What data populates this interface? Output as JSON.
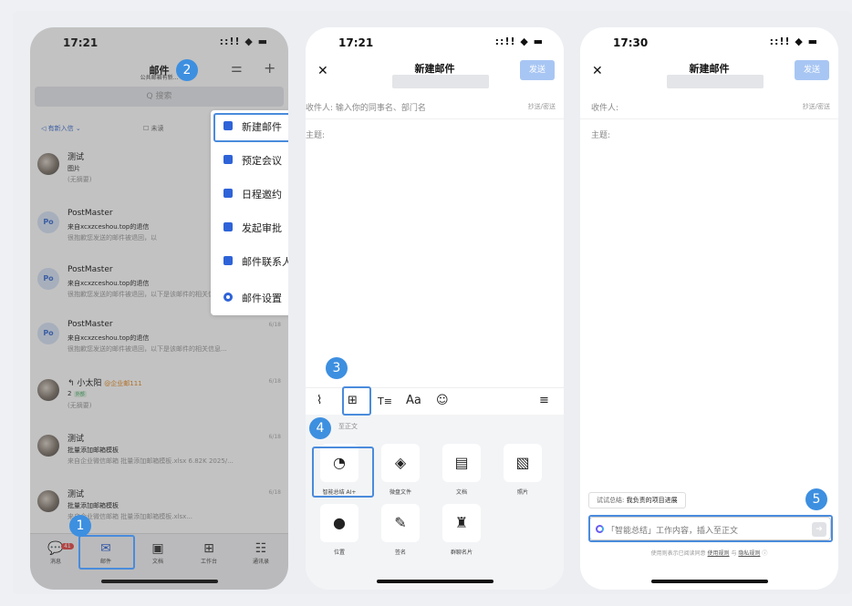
{
  "phone1": {
    "status_time": "17:21",
    "status_icons": "::!! ◆ ▬",
    "header_title": "邮件",
    "header_subtitle": "公共邮箱有新...",
    "filter_icon": "sliders-icon",
    "add_icon": "plus-icon",
    "search_placeholder": "Q 搜索",
    "filter_label": "有新入信",
    "unread_label": "未读",
    "mails": [
      {
        "sender": "测试",
        "subject": "图片",
        "preview": "(无摘要)",
        "date": ""
      },
      {
        "sender": "PostMaster",
        "subject": "来自xcxzceshou.top的退信",
        "preview": "很抱歉您发送的邮件被退回，以",
        "date": ""
      },
      {
        "sender": "PostMaster",
        "subject": "来自xcxzceshou.top的退信",
        "preview": "很抱歉您发送的邮件被退回，以下是该邮件的相关信息...",
        "date": ""
      },
      {
        "sender": "PostMaster",
        "subject": "来自xcxzceshou.top的退信",
        "preview": "很抱歉您发送的邮件被退回，以下是该邮件的相关信息...",
        "date": "6/18"
      },
      {
        "sender": "小太阳",
        "sender_tag": "@企业邮111",
        "subject": "2",
        "subject_tag": "外部",
        "preview": "(无摘要)",
        "date": "6/18"
      },
      {
        "sender": "测试",
        "subject": "批量添加邮箱模板",
        "preview": "来自企业微信邮箱 批量添加邮箱模板.xlsx 6.82K 2025/...",
        "date": "6/18"
      },
      {
        "sender": "测试",
        "subject": "批量添加邮箱模板",
        "preview": "来自企业微信邮箱         批量添加邮箱模板.xlsx...",
        "date": "6/18"
      }
    ],
    "avatar_po": "Po",
    "menu": [
      {
        "label": "新建邮件",
        "icon": "edit-icon"
      },
      {
        "label": "预定会议",
        "icon": "check-icon"
      },
      {
        "label": "日程邀约",
        "icon": "calendar-icon"
      },
      {
        "label": "发起审批",
        "icon": "approval-icon"
      },
      {
        "label": "邮件联系人",
        "icon": "contact-icon"
      },
      {
        "label": "邮件设置",
        "icon": "settings-icon"
      }
    ],
    "tabs": [
      {
        "label": "消息",
        "icon": "💬",
        "badge": "41"
      },
      {
        "label": "邮件",
        "icon": "✉"
      },
      {
        "label": "文档",
        "icon": "▣"
      },
      {
        "label": "工作台",
        "icon": "⊞"
      },
      {
        "label": "通讯录",
        "icon": "☷"
      }
    ]
  },
  "phone2": {
    "status_time": "17:21",
    "status_icons": "::!! ◆ ▬",
    "close": "✕",
    "title": "新建邮件",
    "send": "发送",
    "to_label": "收件人:",
    "to_placeholder": "输入你的同事名、部门名",
    "cc_label": "抄送/密送",
    "subject_label": "主题:",
    "toolbar": [
      "⌇",
      "⊞",
      "T≡",
      "Aa",
      "☺",
      "≡"
    ],
    "insert_hint": "至正文",
    "panel": [
      {
        "label": "智能总结 AI+",
        "icon": "◔"
      },
      {
        "label": "微盘文件",
        "icon": "◈"
      },
      {
        "label": "文档",
        "icon": "▤"
      },
      {
        "label": "照片",
        "icon": "▧"
      },
      {
        "label": "位置",
        "icon": "●"
      },
      {
        "label": "签名",
        "icon": "✎"
      },
      {
        "label": "群聊名片",
        "icon": "♜"
      }
    ]
  },
  "phone3": {
    "status_time": "17:30",
    "status_icons": "::!! ◆ ▬",
    "close": "✕",
    "title": "新建邮件",
    "send": "发送",
    "to_label": "收件人:",
    "cc_label": "抄送/密送",
    "subject_label": "主题:",
    "suggest_prefix": "试试总结:",
    "suggest_text": "我负责的项目进展",
    "ai_placeholder": "「智能总结」工作内容，插入至正文",
    "footer_pre": "使用则表示已阅读同意",
    "footer_link1": "使用规则",
    "footer_and": "与",
    "footer_link2": "隐私规则"
  },
  "steps": [
    "1",
    "2",
    "3",
    "4",
    "5"
  ]
}
